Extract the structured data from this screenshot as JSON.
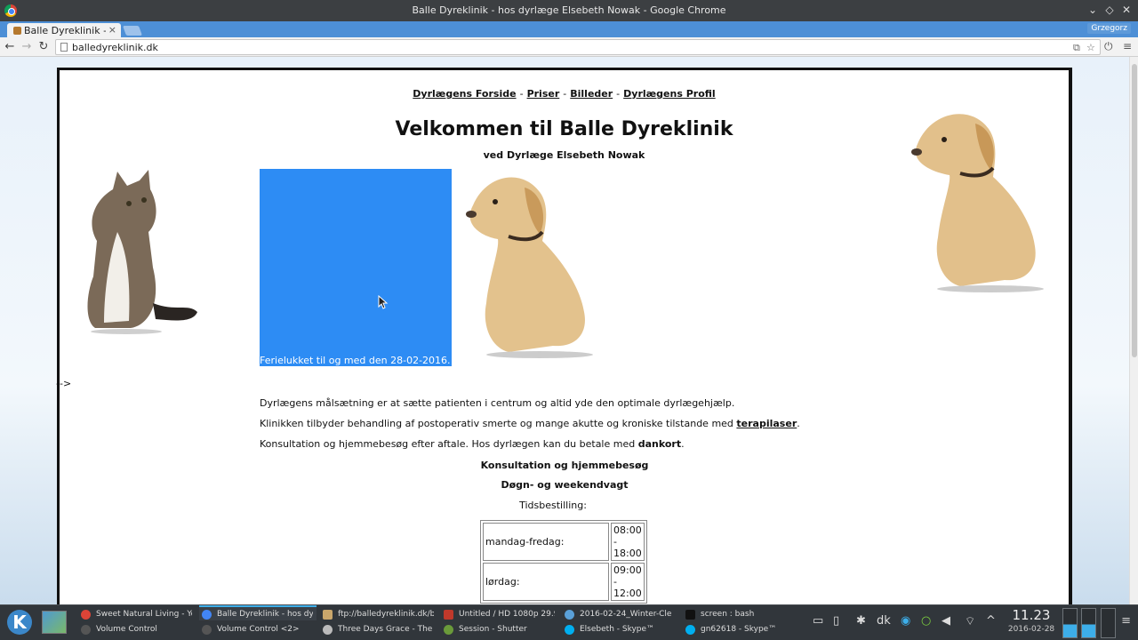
{
  "window": {
    "title": "Balle Dyreklinik - hos dyrlæge Elsebeth Nowak - Google Chrome"
  },
  "tab": {
    "label": "Balle Dyreklinik - hos",
    "close": "×"
  },
  "profile": "Grzegorz",
  "toolbar": {
    "url": "balledyreklinik.dk",
    "back": "←",
    "forward": "→",
    "reload": "↻",
    "menu": "≡"
  },
  "site": {
    "nav": [
      {
        "label": "Dyrlægens Forside"
      },
      {
        "label": "Priser"
      },
      {
        "label": "Billeder"
      },
      {
        "label": "Dyrlægens Profil"
      }
    ],
    "nav_sep": "-",
    "title": "Velkommen til Balle Dyreklinik",
    "subtitle": "ved Dyrlæge Elsebeth Nowak",
    "banner_caption": "Ferielukket til og med den 28-02-2016.",
    "stray_text": "-->",
    "p1": "Dyrlægens målsætning er at sætte patienten i centrum og altid yde den optimale dyrlægehjælp.",
    "p2_before": "Klinikken tilbyder behandling af postoperativ smerte og mange akutte og kroniske tilstande med ",
    "p2_link": "terapilaser",
    "p2_after": ".",
    "p3_before": "Konsultation og hjemmebesøg efter aftale. Hos dyrlægen kan du betale med ",
    "p3_bold": "dankort",
    "p3_after": ".",
    "h_consult": "Konsultation og hjemmebesøg",
    "h_vagt": "Døgn- og weekendvagt",
    "booking_label": "Tidsbestilling:",
    "hours": [
      {
        "day": "mandag-fredag:",
        "from": "08:00",
        "dash": "-",
        "to": "18:00"
      },
      {
        "day": "lørdag:",
        "from": "09:00",
        "dash": "-",
        "to": "12:00"
      }
    ]
  },
  "taskbar": {
    "tasks_top": [
      {
        "label": "Sweet Natural Living - Yo"
      },
      {
        "label": "Balle Dyreklinik - hos dy"
      },
      {
        "label": "ftp://balledyreklinik.dk/b"
      },
      {
        "label": "Untitled / HD 1080p 29.9"
      },
      {
        "label": "2016-02-24_Winter-Cle"
      },
      {
        "label": "screen : bash"
      }
    ],
    "tasks_bottom": [
      {
        "label": "Volume Control"
      },
      {
        "label": "Volume Control <2>"
      },
      {
        "label": "Three Days Grace - The H"
      },
      {
        "label": "Session - Shutter"
      },
      {
        "label": "Elsebeth - Skype™"
      },
      {
        "label": "gn62618 - Skype™"
      }
    ],
    "keyboard": "dk",
    "time": "11.23",
    "date": "2016-02-28"
  }
}
